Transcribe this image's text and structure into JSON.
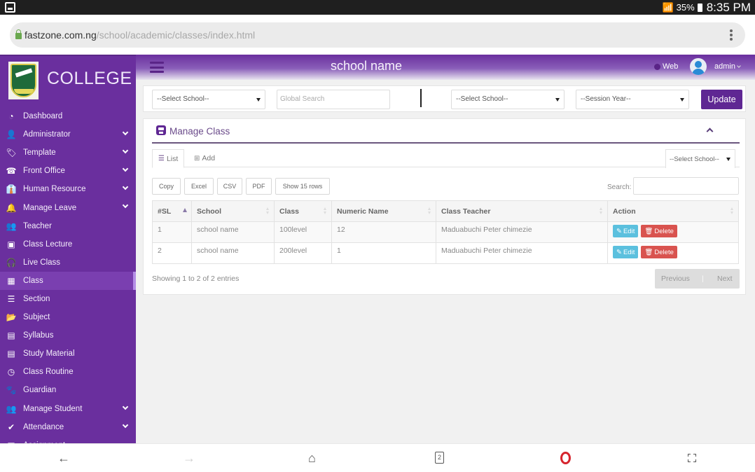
{
  "status_bar": {
    "battery": "35%",
    "time": "8:35 PM"
  },
  "browser": {
    "url_host": "fastzone.com.ng",
    "url_path": "/school/academic/classes/index.html"
  },
  "sidebar": {
    "brand": "COLLEGE",
    "items": [
      {
        "label": "Dashboard",
        "icon": "dashboard-icon",
        "glyph": "◔",
        "expandable": false
      },
      {
        "label": "Administrator",
        "icon": "user-icon",
        "glyph": "👤",
        "expandable": true
      },
      {
        "label": "Template",
        "icon": "tag-icon",
        "glyph": "🏷",
        "expandable": true
      },
      {
        "label": "Front Office",
        "icon": "phone-icon",
        "glyph": "☎",
        "expandable": true
      },
      {
        "label": "Human Resource",
        "icon": "user-tie-icon",
        "glyph": "👔",
        "expandable": true
      },
      {
        "label": "Manage Leave",
        "icon": "bell-icon",
        "glyph": "🔔",
        "expandable": true
      },
      {
        "label": "Teacher",
        "icon": "users-icon",
        "glyph": "👥",
        "expandable": false
      },
      {
        "label": "Class Lecture",
        "icon": "video-file-icon",
        "glyph": "▣",
        "expandable": false
      },
      {
        "label": "Live Class",
        "icon": "headphones-icon",
        "glyph": "🎧",
        "expandable": false
      },
      {
        "label": "Class",
        "icon": "class-icon",
        "glyph": "▦",
        "expandable": false,
        "active": true
      },
      {
        "label": "Section",
        "icon": "bars-icon",
        "glyph": "☰",
        "expandable": false
      },
      {
        "label": "Subject",
        "icon": "folder-open-icon",
        "glyph": "📂",
        "expandable": false
      },
      {
        "label": "Syllabus",
        "icon": "files-icon",
        "glyph": "▤",
        "expandable": false
      },
      {
        "label": "Study Material",
        "icon": "document-icon",
        "glyph": "▤",
        "expandable": false
      },
      {
        "label": "Class Routine",
        "icon": "clock-icon",
        "glyph": "◷",
        "expandable": false
      },
      {
        "label": "Guardian",
        "icon": "paw-icon",
        "glyph": "🐾",
        "expandable": false
      },
      {
        "label": "Manage Student",
        "icon": "users-icon",
        "glyph": "👥",
        "expandable": true
      },
      {
        "label": "Attendance",
        "icon": "check-circle-icon",
        "glyph": "✔",
        "expandable": true
      },
      {
        "label": "Assignment",
        "icon": "assignment-icon",
        "glyph": "▤",
        "expandable": false
      }
    ]
  },
  "header": {
    "title": "school name",
    "web_link": "Web",
    "user": "admin"
  },
  "filter_bar": {
    "school_select_1": "--Select School--",
    "global_search_placeholder": "Global Search",
    "school_select_2": "--Select School--",
    "session_select": "--Session Year--",
    "update_label": "Update"
  },
  "panel": {
    "title": "Manage Class",
    "tabs": {
      "list": "List",
      "add": "Add",
      "school_filter": "--Select School--"
    },
    "export_buttons": [
      "Copy",
      "Excel",
      "CSV",
      "PDF",
      "Show 15 rows"
    ],
    "search_label": "Search:",
    "table": {
      "columns": [
        "#SL",
        "School",
        "Class",
        "Numeric Name",
        "Class Teacher",
        "Action"
      ],
      "rows": [
        {
          "sl": "1",
          "school": "school name",
          "class": "100level",
          "numeric": "12",
          "teacher": "Maduabuchi Peter chimezie"
        },
        {
          "sl": "2",
          "school": "school name",
          "class": "200level",
          "numeric": "1",
          "teacher": "Maduabuchi Peter chimezie"
        }
      ],
      "edit_label": "Edit",
      "delete_label": "Delete"
    },
    "info": "Showing 1 to 2 of 2 entries",
    "pager": {
      "previous": "Previous",
      "separator": "|",
      "next": "Next"
    }
  },
  "bottom_nav": {
    "tab_count": "2"
  },
  "colors": {
    "sidebar_bg": "#6a2f9e",
    "accent": "#5f2793",
    "edit": "#5bc0de",
    "delete": "#d9534f",
    "opera": "#d6242d"
  }
}
